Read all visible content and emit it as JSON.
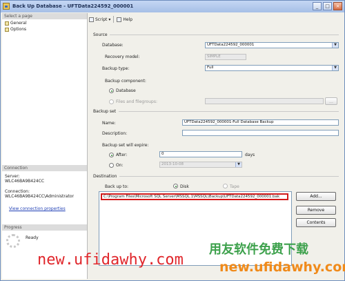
{
  "window": {
    "title": "Back Up Database - UFTData224592_000001"
  },
  "title_buttons": [
    "_",
    "□",
    "×"
  ],
  "left_pane": {
    "select_page_header": "Select a page",
    "pages": [
      "General",
      "Options"
    ],
    "connection_header": "Connection",
    "server_label": "Server:",
    "server_value": "WLC46BA9B424CC",
    "connection_label": "Connection:",
    "connection_value": "WLC46BA9B424CC\\Administrator",
    "view_link": "View connection properties",
    "progress_header": "Progress",
    "progress_status": "Ready"
  },
  "toolbar": {
    "script": "Script",
    "help": "Help"
  },
  "source": {
    "header": "Source",
    "database_label": "Database:",
    "database_value": "UFTData224592_000001",
    "recovery_label": "Recovery model:",
    "recovery_value": "SIMPLE",
    "backup_type_label": "Backup type:",
    "backup_type_value": "Full",
    "component_label": "Backup component:",
    "component_database": "Database",
    "component_files": "Files and filegroups:"
  },
  "backup_set": {
    "header": "Backup set",
    "name_label": "Name:",
    "name_value": "UFTData224592_000001-Full Database Backup",
    "description_label": "Description:",
    "description_value": "",
    "expire_label": "Backup set will expire:",
    "after_label": "After:",
    "after_value": "0",
    "days_label": "days",
    "on_label": "On:",
    "on_value": "2013-10-08"
  },
  "destination": {
    "header": "Destination",
    "backup_to_label": "Back up to:",
    "disk_label": "Disk",
    "tape_label": "Tape",
    "path": "C:\\Program Files\\Microsoft SQL Server\\MSSQL.1\\MSSQL\\Backup\\UFTData224592_000001.bak",
    "add_button": "Add...",
    "remove_button": "Remove",
    "contents_button": "Contents"
  },
  "watermark": {
    "url_red": "new.ufidawhy.com",
    "cn_green": "用友软件免费下载",
    "url_orange": "new.ufidawhy.com"
  },
  "colors": {
    "watermark_red": "#e0262b",
    "watermark_green": "#3da14c",
    "watermark_orange": "#f08a1a",
    "highlight": "#d11a1a"
  }
}
